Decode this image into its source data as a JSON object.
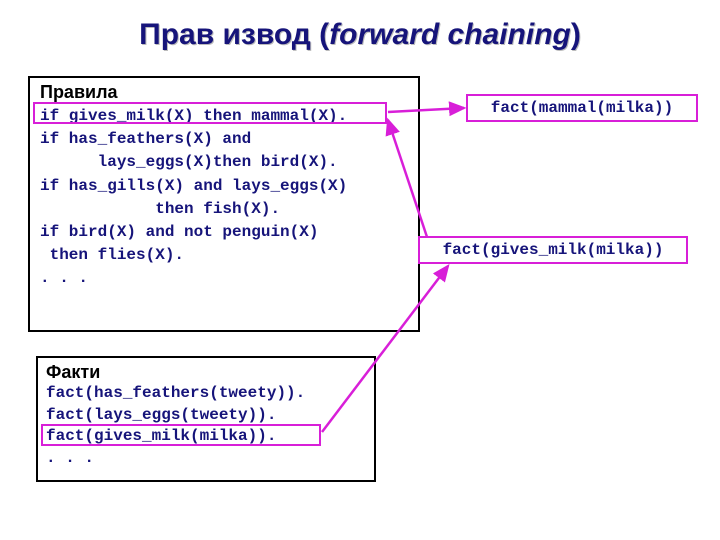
{
  "title_part1": "Прав извод (",
  "title_italic": "forward chaining",
  "title_part2": ")",
  "rules": {
    "header": "Правила",
    "line1": "if gives_milk(X) then mammal(X).",
    "line2": "if has_feathers(X) and",
    "line3": "      lays_eggs(X)then bird(X).",
    "line4": "if has_gills(X) and lays_eggs(X)",
    "line5": "            then fish(X).",
    "line6": "if bird(X) and not penguin(X)",
    "line7": " then flies(X).",
    "line8": ". . ."
  },
  "derived": {
    "fact1": "fact(mammal(milka))",
    "fact2": "fact(gives_milk(milka))"
  },
  "facts": {
    "header": "Факти",
    "line1": "fact(has_feathers(tweety)).",
    "line2": "fact(lays_eggs(tweety)).",
    "line3": "fact(gives_milk(milka)).",
    "line4": ". . ."
  }
}
